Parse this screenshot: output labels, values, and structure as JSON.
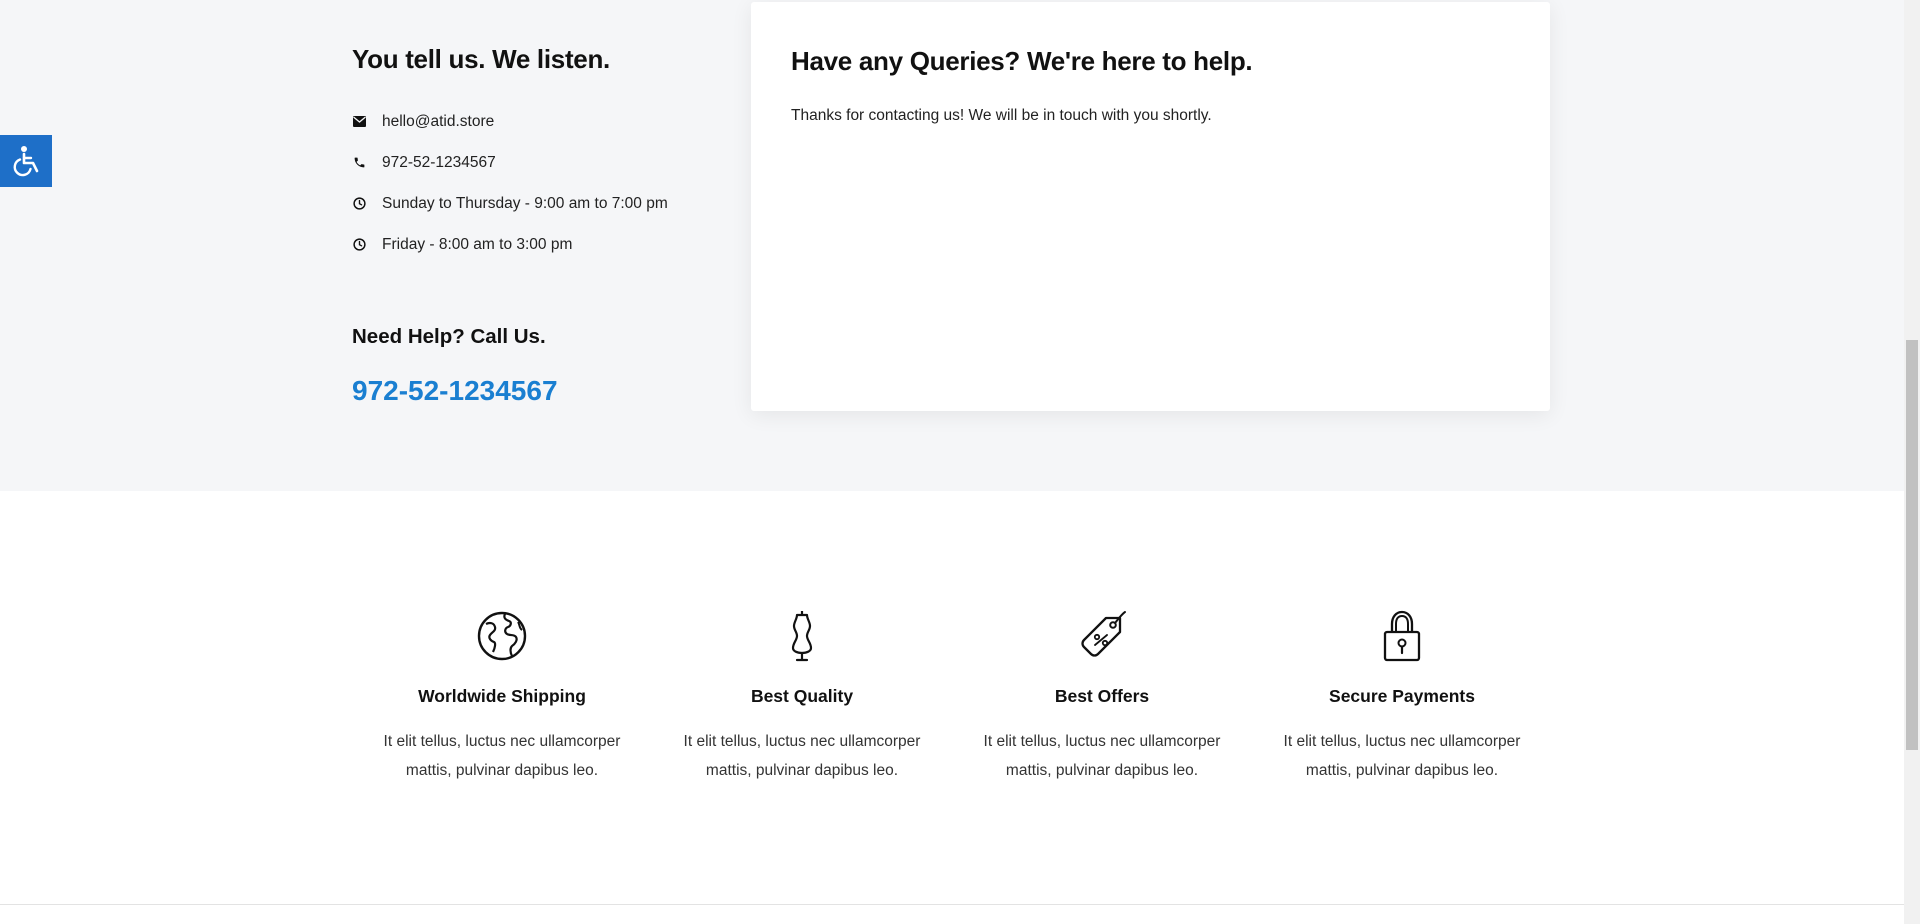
{
  "contact": {
    "title": "You tell us. We listen.",
    "items": [
      {
        "icon": "envelope-icon",
        "text": "hello@atid.store"
      },
      {
        "icon": "phone-icon",
        "text": "972-52-1234567"
      },
      {
        "icon": "clock-icon",
        "text": "Sunday to Thursday - 9:00 am to 7:00 pm"
      },
      {
        "icon": "clock-icon",
        "text": "Friday - 8:00 am to 3:00 pm"
      }
    ],
    "help_title": "Need Help? Call Us.",
    "help_phone": "972-52-1234567"
  },
  "form": {
    "title": "Have any Queries? We're here to help.",
    "message": "Thanks for contacting us! We will be in touch with you shortly."
  },
  "accessibility": {
    "icon": "wheelchair-icon"
  },
  "features": [
    {
      "icon": "globe-icon",
      "title": "Worldwide Shipping",
      "desc_line1": "It elit tellus, luctus nec ullamcorper",
      "desc_line2": "mattis, pulvinar dapibus leo."
    },
    {
      "icon": "mannequin-icon",
      "title": "Best Quality",
      "desc_line1": "It elit tellus, luctus nec ullamcorper",
      "desc_line2": "mattis, pulvinar dapibus leo."
    },
    {
      "icon": "price-tag-icon",
      "title": "Best Offers",
      "desc_line1": "It elit tellus, luctus nec ullamcorper",
      "desc_line2": "mattis, pulvinar dapibus leo."
    },
    {
      "icon": "padlock-icon",
      "title": "Secure Payments",
      "desc_line1": "It elit tellus, luctus nec ullamcorper",
      "desc_line2": "mattis, pulvinar dapibus leo."
    }
  ],
  "colors": {
    "accent": "#1a7fd1",
    "accessibility_bg": "#1e6fc8",
    "section_bg": "#f5f6f8"
  }
}
